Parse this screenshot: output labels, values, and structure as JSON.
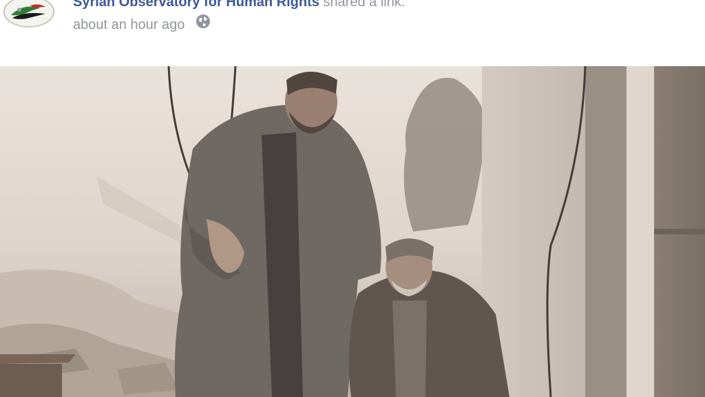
{
  "post": {
    "page_name": "Syrian Observatory for Human Rights",
    "action": "shared a link.",
    "timestamp": "about an hour ago",
    "privacy_icon": "globe-icon",
    "avatar_icon": "page-logo-icon"
  },
  "colors": {
    "link": "#3b5998",
    "meta": "#90949c",
    "background": "#ffffff"
  }
}
